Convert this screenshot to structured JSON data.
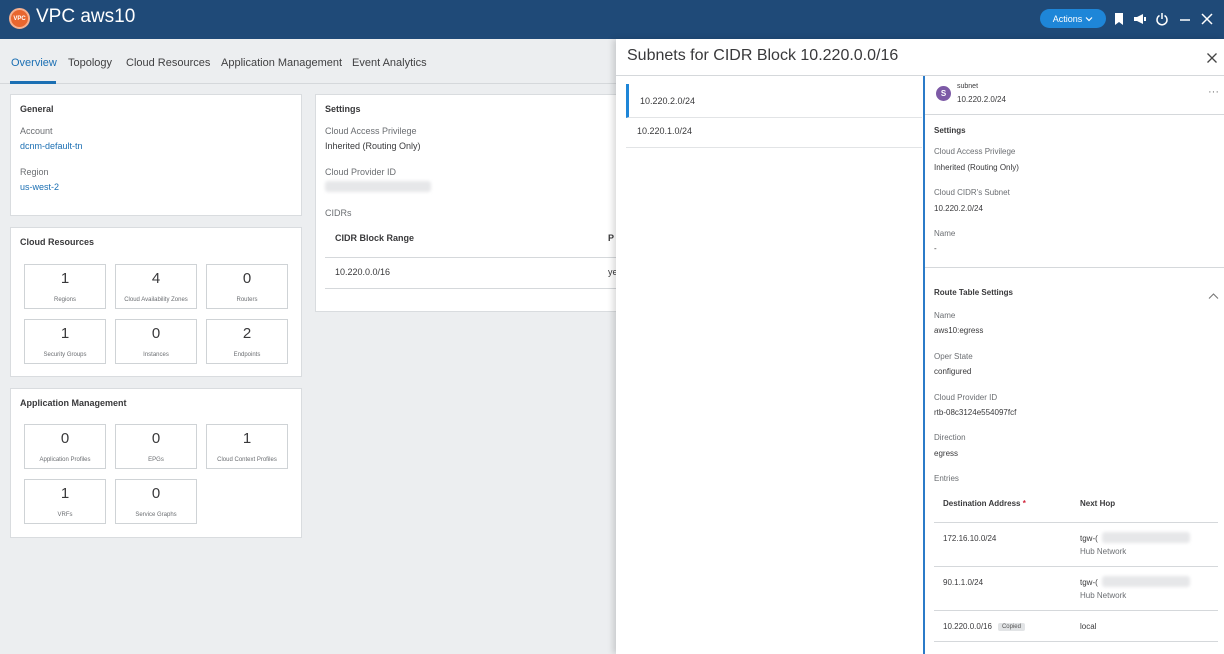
{
  "header": {
    "badge": "VPC",
    "title": "VPC aws10",
    "actions_label": "Actions",
    "icons": [
      "bookmark-icon",
      "megaphone-icon",
      "power-icon",
      "minimize-icon",
      "close-icon"
    ]
  },
  "tabs": [
    {
      "label": "Overview",
      "active": true
    },
    {
      "label": "Topology"
    },
    {
      "label": "Cloud Resources"
    },
    {
      "label": "Application Management"
    },
    {
      "label": "Event Analytics"
    }
  ],
  "general": {
    "title": "General",
    "account_label": "Account",
    "account_value": "dcnm-default-tn",
    "region_label": "Region",
    "region_value": "us-west-2"
  },
  "cloud_resources": {
    "title": "Cloud Resources",
    "tiles": [
      {
        "count": "1",
        "label": "Regions"
      },
      {
        "count": "4",
        "label": "Cloud Availability Zones"
      },
      {
        "count": "0",
        "label": "Routers"
      },
      {
        "count": "1",
        "label": "Security Groups"
      },
      {
        "count": "0",
        "label": "Instances"
      },
      {
        "count": "2",
        "label": "Endpoints"
      }
    ]
  },
  "application_management": {
    "title": "Application Management",
    "tiles": [
      {
        "count": "0",
        "label": "Application Profiles"
      },
      {
        "count": "0",
        "label": "EPGs"
      },
      {
        "count": "1",
        "label": "Cloud Context Profiles"
      },
      {
        "count": "1",
        "label": "VRFs"
      },
      {
        "count": "0",
        "label": "Service Graphs"
      }
    ]
  },
  "settings": {
    "title": "Settings",
    "access_label": "Cloud Access Privilege",
    "access_value": "Inherited (Routing Only)",
    "provider_label": "Cloud Provider ID",
    "cidrs_label": "CIDRs",
    "col_range": "CIDR Block Range",
    "col_primary": "P",
    "row_range": "10.220.0.0/16",
    "row_primary": "ye"
  },
  "panel": {
    "title": "Subnets for CIDR Block 10.220.0.0/16",
    "subnets": [
      "10.220.2.0/24",
      "10.220.1.0/24"
    ],
    "detail": {
      "type_label": "subnet",
      "avatar_letter": "S",
      "name": "10.220.2.0/24",
      "more": "···",
      "settings_title": "Settings",
      "access_label": "Cloud Access Privilege",
      "access_value": "Inherited (Routing Only)",
      "cidr_subnet_label": "Cloud CIDR's Subnet",
      "cidr_subnet_value": "10.220.2.0/24",
      "name_label": "Name",
      "name_value": "-",
      "route_title": "Route Table Settings",
      "rt_name_label": "Name",
      "rt_name_value": "aws10:egress",
      "oper_label": "Oper State",
      "oper_value": "configured",
      "provider_label": "Cloud Provider ID",
      "provider_value": "rtb-08c3124e554097fcf",
      "direction_label": "Direction",
      "direction_value": "egress",
      "entries_label": "Entries",
      "col_dest": "Destination Address",
      "col_required": "*",
      "col_hop": "Next Hop",
      "entries": [
        {
          "dest": "172.16.10.0/24",
          "hop": "tgw-(",
          "hop_sub": "Hub Network"
        },
        {
          "dest": "90.1.1.0/24",
          "hop": "tgw-(",
          "hop_sub": "Hub Network"
        },
        {
          "dest": "10.220.0.0/16",
          "badge": "Copied",
          "hop": "local"
        }
      ]
    }
  },
  "colors": {
    "header_bg": "#1f4a78",
    "accent": "#1b6fb3",
    "actions_bg": "#1e86d8",
    "vpc_badge": "#e8662f",
    "subnet_avatar": "#7d5aa6"
  }
}
